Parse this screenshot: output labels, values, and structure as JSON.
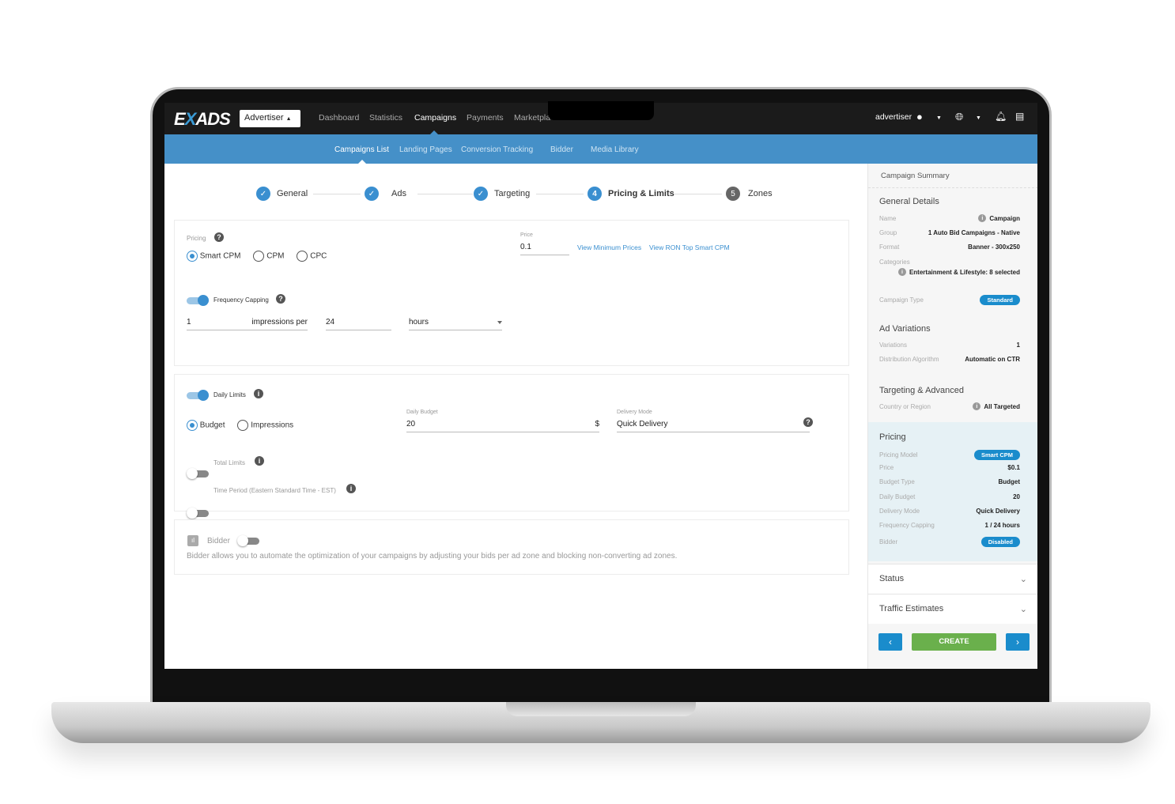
{
  "app": {
    "logo": "EXADS",
    "role_selector": "Advertiser"
  },
  "topnav": {
    "items": [
      "Dashboard",
      "Statistics",
      "Campaigns",
      "Payments",
      "Marketpla"
    ],
    "active": "Campaigns",
    "user": "advertiser"
  },
  "subnav": {
    "items": [
      "Campaigns List",
      "Landing Pages",
      "Conversion Tracking",
      "Bidder",
      "Media Library"
    ],
    "active": "Campaigns List"
  },
  "steps": [
    {
      "label": "General",
      "state": "done"
    },
    {
      "label": "Ads",
      "state": "done"
    },
    {
      "label": "Targeting",
      "state": "done"
    },
    {
      "num": "4",
      "label": "Pricing & Limits",
      "state": "current"
    },
    {
      "num": "5",
      "label": "Zones",
      "state": "pending"
    }
  ],
  "pricing": {
    "label": "Pricing",
    "options": [
      "Smart CPM",
      "CPM",
      "CPC"
    ],
    "selected": "Smart CPM",
    "price_label": "Price",
    "price_value": "0.1",
    "link_min": "View Minimum Prices",
    "link_ron": "View RON Top Smart CPM",
    "freq_label": "Frequency Capping",
    "freq_enabled": true,
    "freq_impressions": "1",
    "freq_per": "impressions per",
    "freq_period": "24",
    "freq_unit": "hours"
  },
  "limits": {
    "daily_label": "Daily Limits",
    "daily_enabled": true,
    "options": [
      "Budget",
      "Impressions"
    ],
    "selected": "Budget",
    "daily_budget_label": "Daily Budget",
    "daily_budget": "20",
    "currency": "$",
    "delivery_label": "Delivery Mode",
    "delivery_value": "Quick Delivery",
    "total_label": "Total Limits",
    "total_enabled": false,
    "time_label": "Time Period (Eastern Standard Time - EST)",
    "time_enabled": false
  },
  "bidder": {
    "label": "Bidder",
    "enabled": false,
    "description": "Bidder allows you to automate the optimization of your campaigns by adjusting your bids per ad zone and blocking non-converting ad zones."
  },
  "summary": {
    "title": "Campaign Summary",
    "general": {
      "heading": "General Details",
      "name_k": "Name",
      "name_v": "Campaign",
      "group_k": "Group",
      "group_v": "1 Auto Bid Campaigns - Native",
      "format_k": "Format",
      "format_v": "Banner - 300x250",
      "cat_k": "Categories",
      "cat_v": "Entertainment & Lifestyle: 8 selected",
      "type_k": "Campaign Type",
      "type_v": "Standard"
    },
    "ads": {
      "heading": "Ad Variations",
      "var_k": "Variations",
      "var_v": "1",
      "algo_k": "Distribution Algorithm",
      "algo_v": "Automatic on CTR"
    },
    "targeting": {
      "heading": "Targeting & Advanced",
      "country_k": "Country or Region",
      "country_v": "All Targeted"
    },
    "pricing": {
      "heading": "Pricing",
      "model_k": "Pricing Model",
      "model_v": "Smart CPM",
      "price_k": "Price",
      "price_v": "$0.1",
      "btype_k": "Budget Type",
      "btype_v": "Budget",
      "daily_k": "Daily Budget",
      "daily_v": "20",
      "mode_k": "Delivery Mode",
      "mode_v": "Quick Delivery",
      "freq_k": "Frequency Capping",
      "freq_v": "1 / 24 hours",
      "bidder_k": "Bidder",
      "bidder_v": "Disabled"
    },
    "status": "Status",
    "traffic": "Traffic Estimates",
    "create": "CREATE"
  },
  "colors": {
    "accent": "#1a8ccc",
    "subnav": "#4590c8",
    "create": "#6ab04c",
    "topbar": "#1b1b1b",
    "pricing_bg": "#e6f1f5"
  }
}
